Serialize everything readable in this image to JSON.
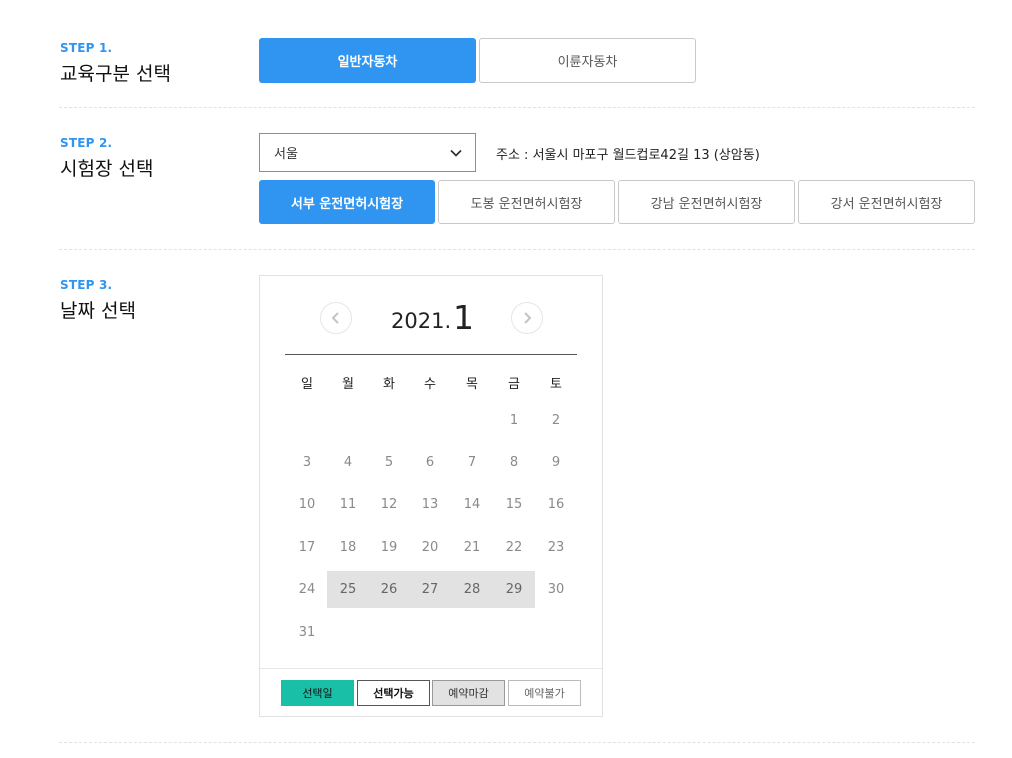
{
  "step1": {
    "label": "STEP 1.",
    "title": "교육구분 선택",
    "options": [
      "일반자동차",
      "이륜자동차"
    ]
  },
  "step2": {
    "label": "STEP 2.",
    "title": "시험장 선택",
    "region_value": "서울",
    "address": "주소 : 서울시 마포구 월드컵로42길 13 (상암동)",
    "centers": [
      "서부 운전면허시험장",
      "도봉 운전면허시험장",
      "강남 운전면허시험장",
      "강서 운전면허시험장"
    ]
  },
  "step3": {
    "label": "STEP 3.",
    "title": "날짜 선택"
  },
  "calendar": {
    "year": "2021.",
    "month": "1",
    "weekdays": [
      "일",
      "월",
      "화",
      "수",
      "목",
      "금",
      "토"
    ],
    "days": [
      "1",
      "2",
      "3",
      "4",
      "5",
      "6",
      "7",
      "8",
      "9",
      "10",
      "11",
      "12",
      "13",
      "14",
      "15",
      "16",
      "17",
      "18",
      "19",
      "20",
      "21",
      "22",
      "23",
      "24",
      "25",
      "26",
      "27",
      "28",
      "29",
      "30",
      "31"
    ],
    "first_weekday_index": 5,
    "closed_days": [
      25,
      26,
      27,
      28,
      29
    ],
    "legend": {
      "selected": "선택일",
      "available": "선택가능",
      "closed": "예약마감",
      "unavailable": "예약불가"
    }
  },
  "colors": {
    "accent": "#2f95f0",
    "selected": "#1abfa8",
    "closed_bg": "#e2e2e2"
  },
  "icons": {
    "region_select": "chevron-down-icon",
    "prev_month": "chevron-left-icon",
    "next_month": "chevron-right-icon"
  }
}
